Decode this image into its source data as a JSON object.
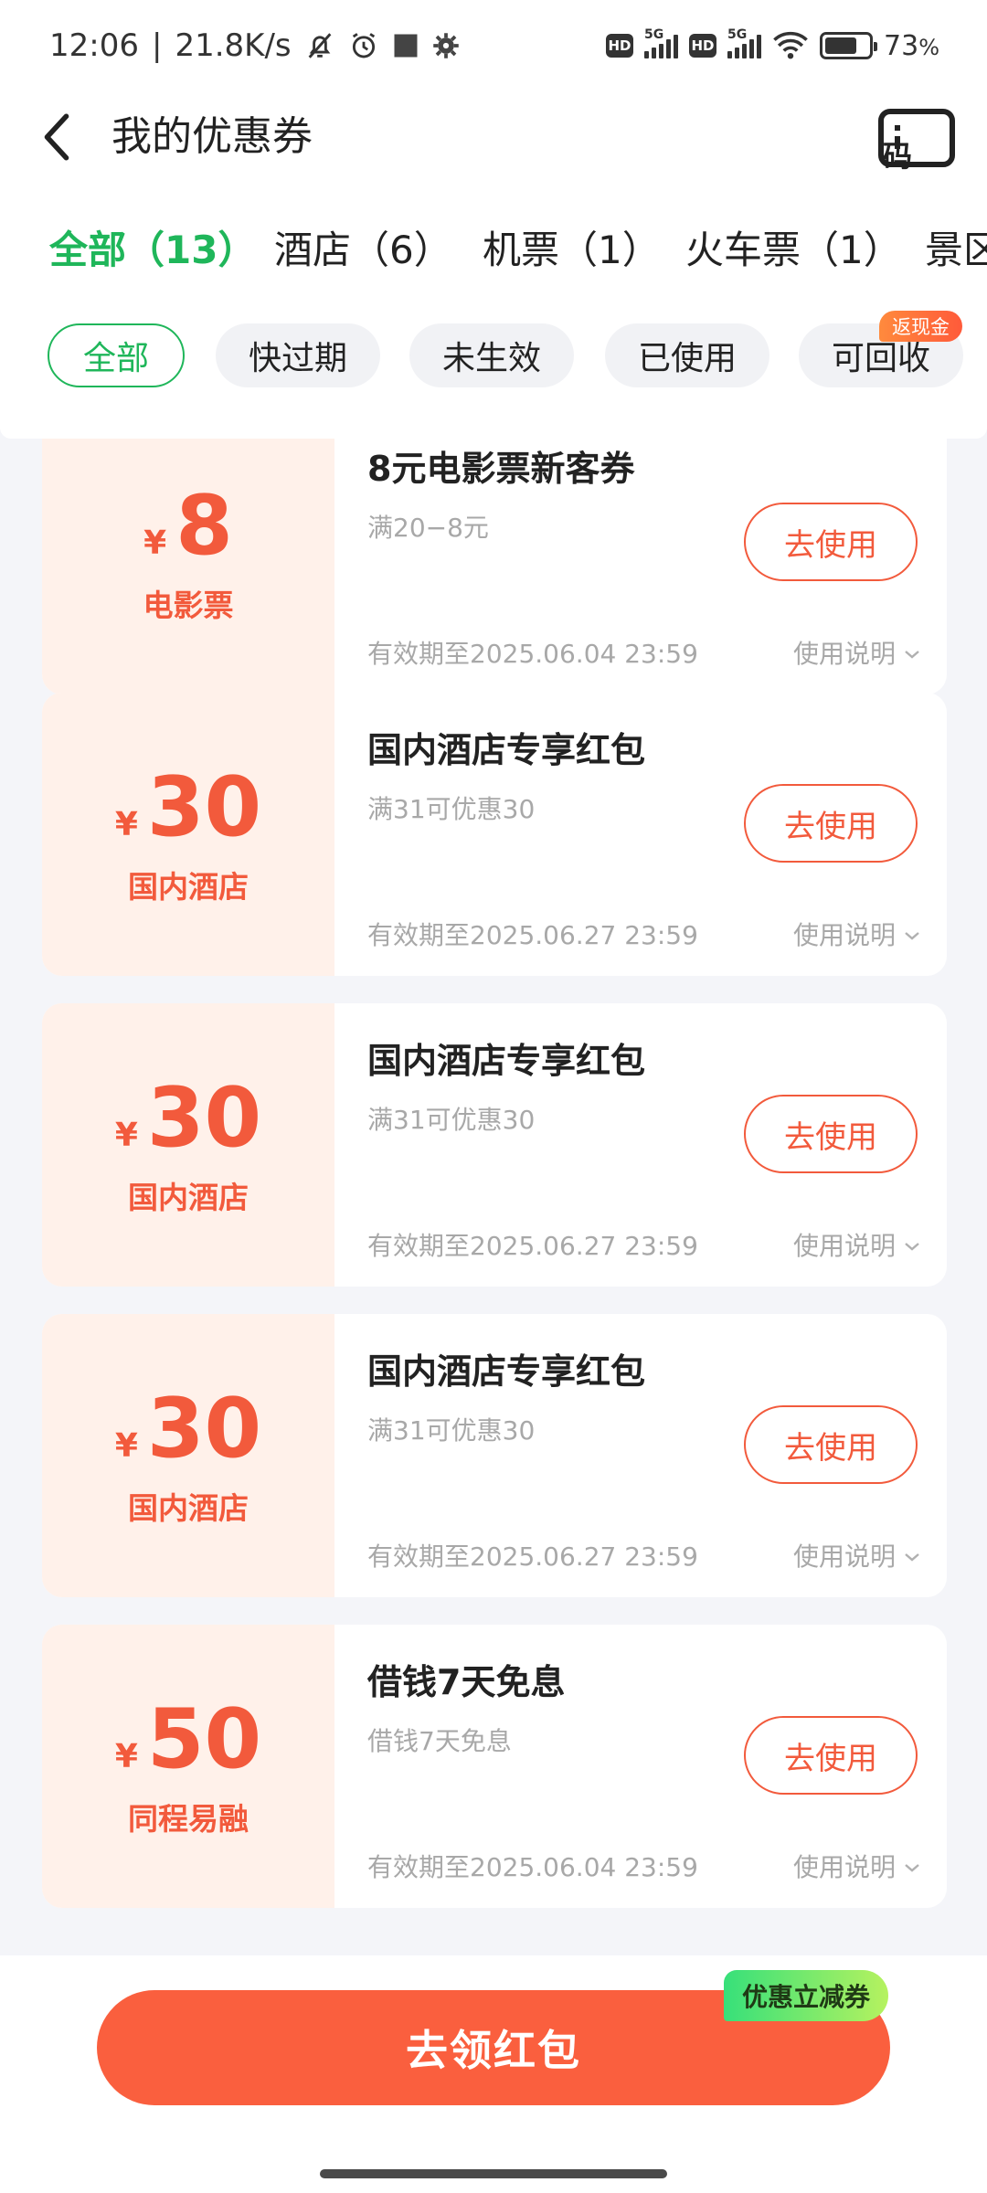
{
  "status_bar": {
    "time": "12:06",
    "speed": "21.8K/s",
    "network1": "5G",
    "network2": "5G",
    "hd": "HD",
    "battery": "73",
    "battery_unit": "%"
  },
  "header": {
    "title": "我的优惠券",
    "code_label": "码"
  },
  "tabs": [
    {
      "label": "全部（13）"
    },
    {
      "label": "酒店（6）"
    },
    {
      "label": "机票（1）"
    },
    {
      "label": "火车票（1）"
    },
    {
      "label": "景区"
    }
  ],
  "chips": [
    {
      "label": "全部"
    },
    {
      "label": "快过期"
    },
    {
      "label": "未生效"
    },
    {
      "label": "已使用"
    },
    {
      "label": "可回收",
      "badge": "返现金"
    }
  ],
  "coupons": [
    {
      "amount": "8",
      "currency": "¥",
      "category": "电影票",
      "title": "8元电影票新客券",
      "desc": "满20−8元",
      "expiry": "有效期至2025.06.04 23:59",
      "info": "使用说明",
      "button": "去使用"
    },
    {
      "amount": "30",
      "currency": "¥",
      "category": "国内酒店",
      "title": "国内酒店专享红包",
      "desc": "满31可优惠30",
      "expiry": "有效期至2025.06.27 23:59",
      "info": "使用说明",
      "button": "去使用"
    },
    {
      "amount": "30",
      "currency": "¥",
      "category": "国内酒店",
      "title": "国内酒店专享红包",
      "desc": "满31可优惠30",
      "expiry": "有效期至2025.06.27 23:59",
      "info": "使用说明",
      "button": "去使用"
    },
    {
      "amount": "30",
      "currency": "¥",
      "category": "国内酒店",
      "title": "国内酒店专享红包",
      "desc": "满31可优惠30",
      "expiry": "有效期至2025.06.27 23:59",
      "info": "使用说明",
      "button": "去使用"
    },
    {
      "amount": "50",
      "currency": "¥",
      "category": "同程易融",
      "title": "借钱7天免息",
      "desc": "借钱7天免息",
      "expiry": "有效期至2025.06.04 23:59",
      "info": "使用说明",
      "button": "去使用"
    }
  ],
  "bottom": {
    "cta_label": "去领红包",
    "cta_badge": "优惠立减券"
  },
  "colors": {
    "accent_green": "#1fb65a",
    "coupon_orange": "#f25a3c",
    "cta_orange": "#fa5f3e"
  }
}
